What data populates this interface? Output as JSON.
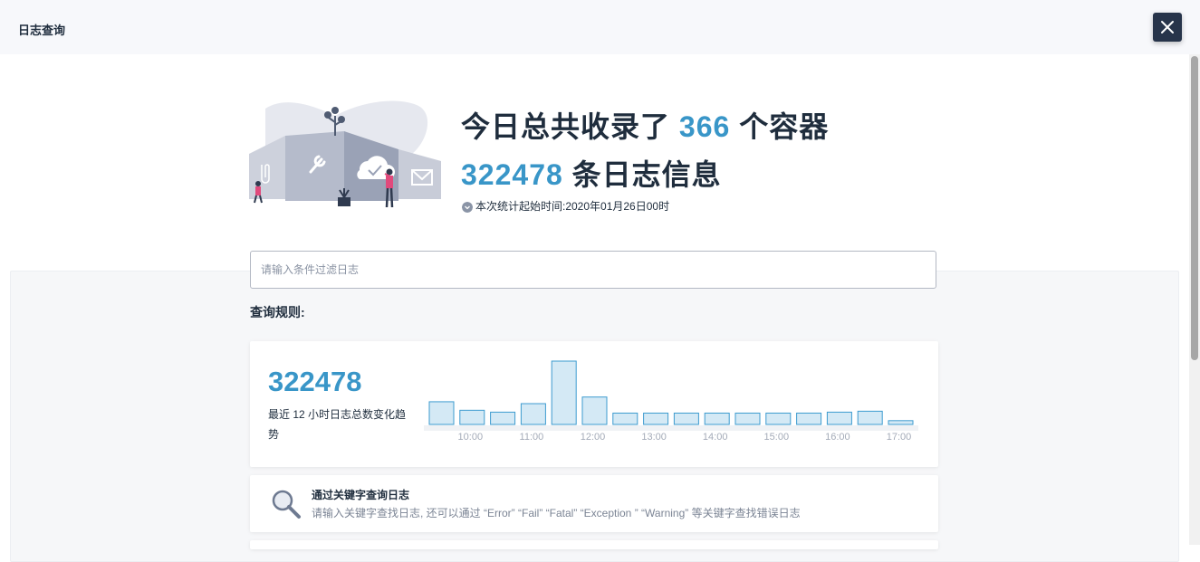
{
  "header": {
    "title": "日志查询",
    "close_icon": "close-icon"
  },
  "headline": {
    "line1_prefix": "今日总共收录了",
    "container_count": "366",
    "line1_suffix": "个容器",
    "log_count": "322478",
    "line2_suffix": "条日志信息"
  },
  "since": {
    "icon": "chevron-down-circle-icon",
    "text": "本次统计起始时间:2020年01月26日00时"
  },
  "search": {
    "placeholder": "请输入条件过滤日志",
    "value": ""
  },
  "rules": {
    "title": "查询规则:"
  },
  "stats": {
    "total": "322478",
    "description": "最近 12 小时日志总数变化趋势"
  },
  "keyword_rule": {
    "icon": "search-icon",
    "title": "通过关键字查询日志",
    "description": "请输入关键字查找日志, 还可以通过 “Error” “Fail” “Fatal” “Exception ” “Warning” 等关键字查找错误日志"
  },
  "colors": {
    "accent": "#3996c8",
    "bar_fill": "#d4e9f5",
    "bar_stroke": "#3d9bcf",
    "text": "#1f2d3d"
  },
  "chart_data": {
    "type": "bar",
    "title": "",
    "xlabel": "",
    "ylabel": "",
    "x_tick_labels": [
      "10:00",
      "11:00",
      "12:00",
      "13:00",
      "14:00",
      "15:00",
      "16:00",
      "17:00"
    ],
    "values": [
      24,
      15,
      13,
      22,
      67,
      29,
      12,
      12,
      12,
      12,
      12,
      12,
      12,
      13,
      14,
      4
    ],
    "grid": false,
    "legend": "none"
  }
}
